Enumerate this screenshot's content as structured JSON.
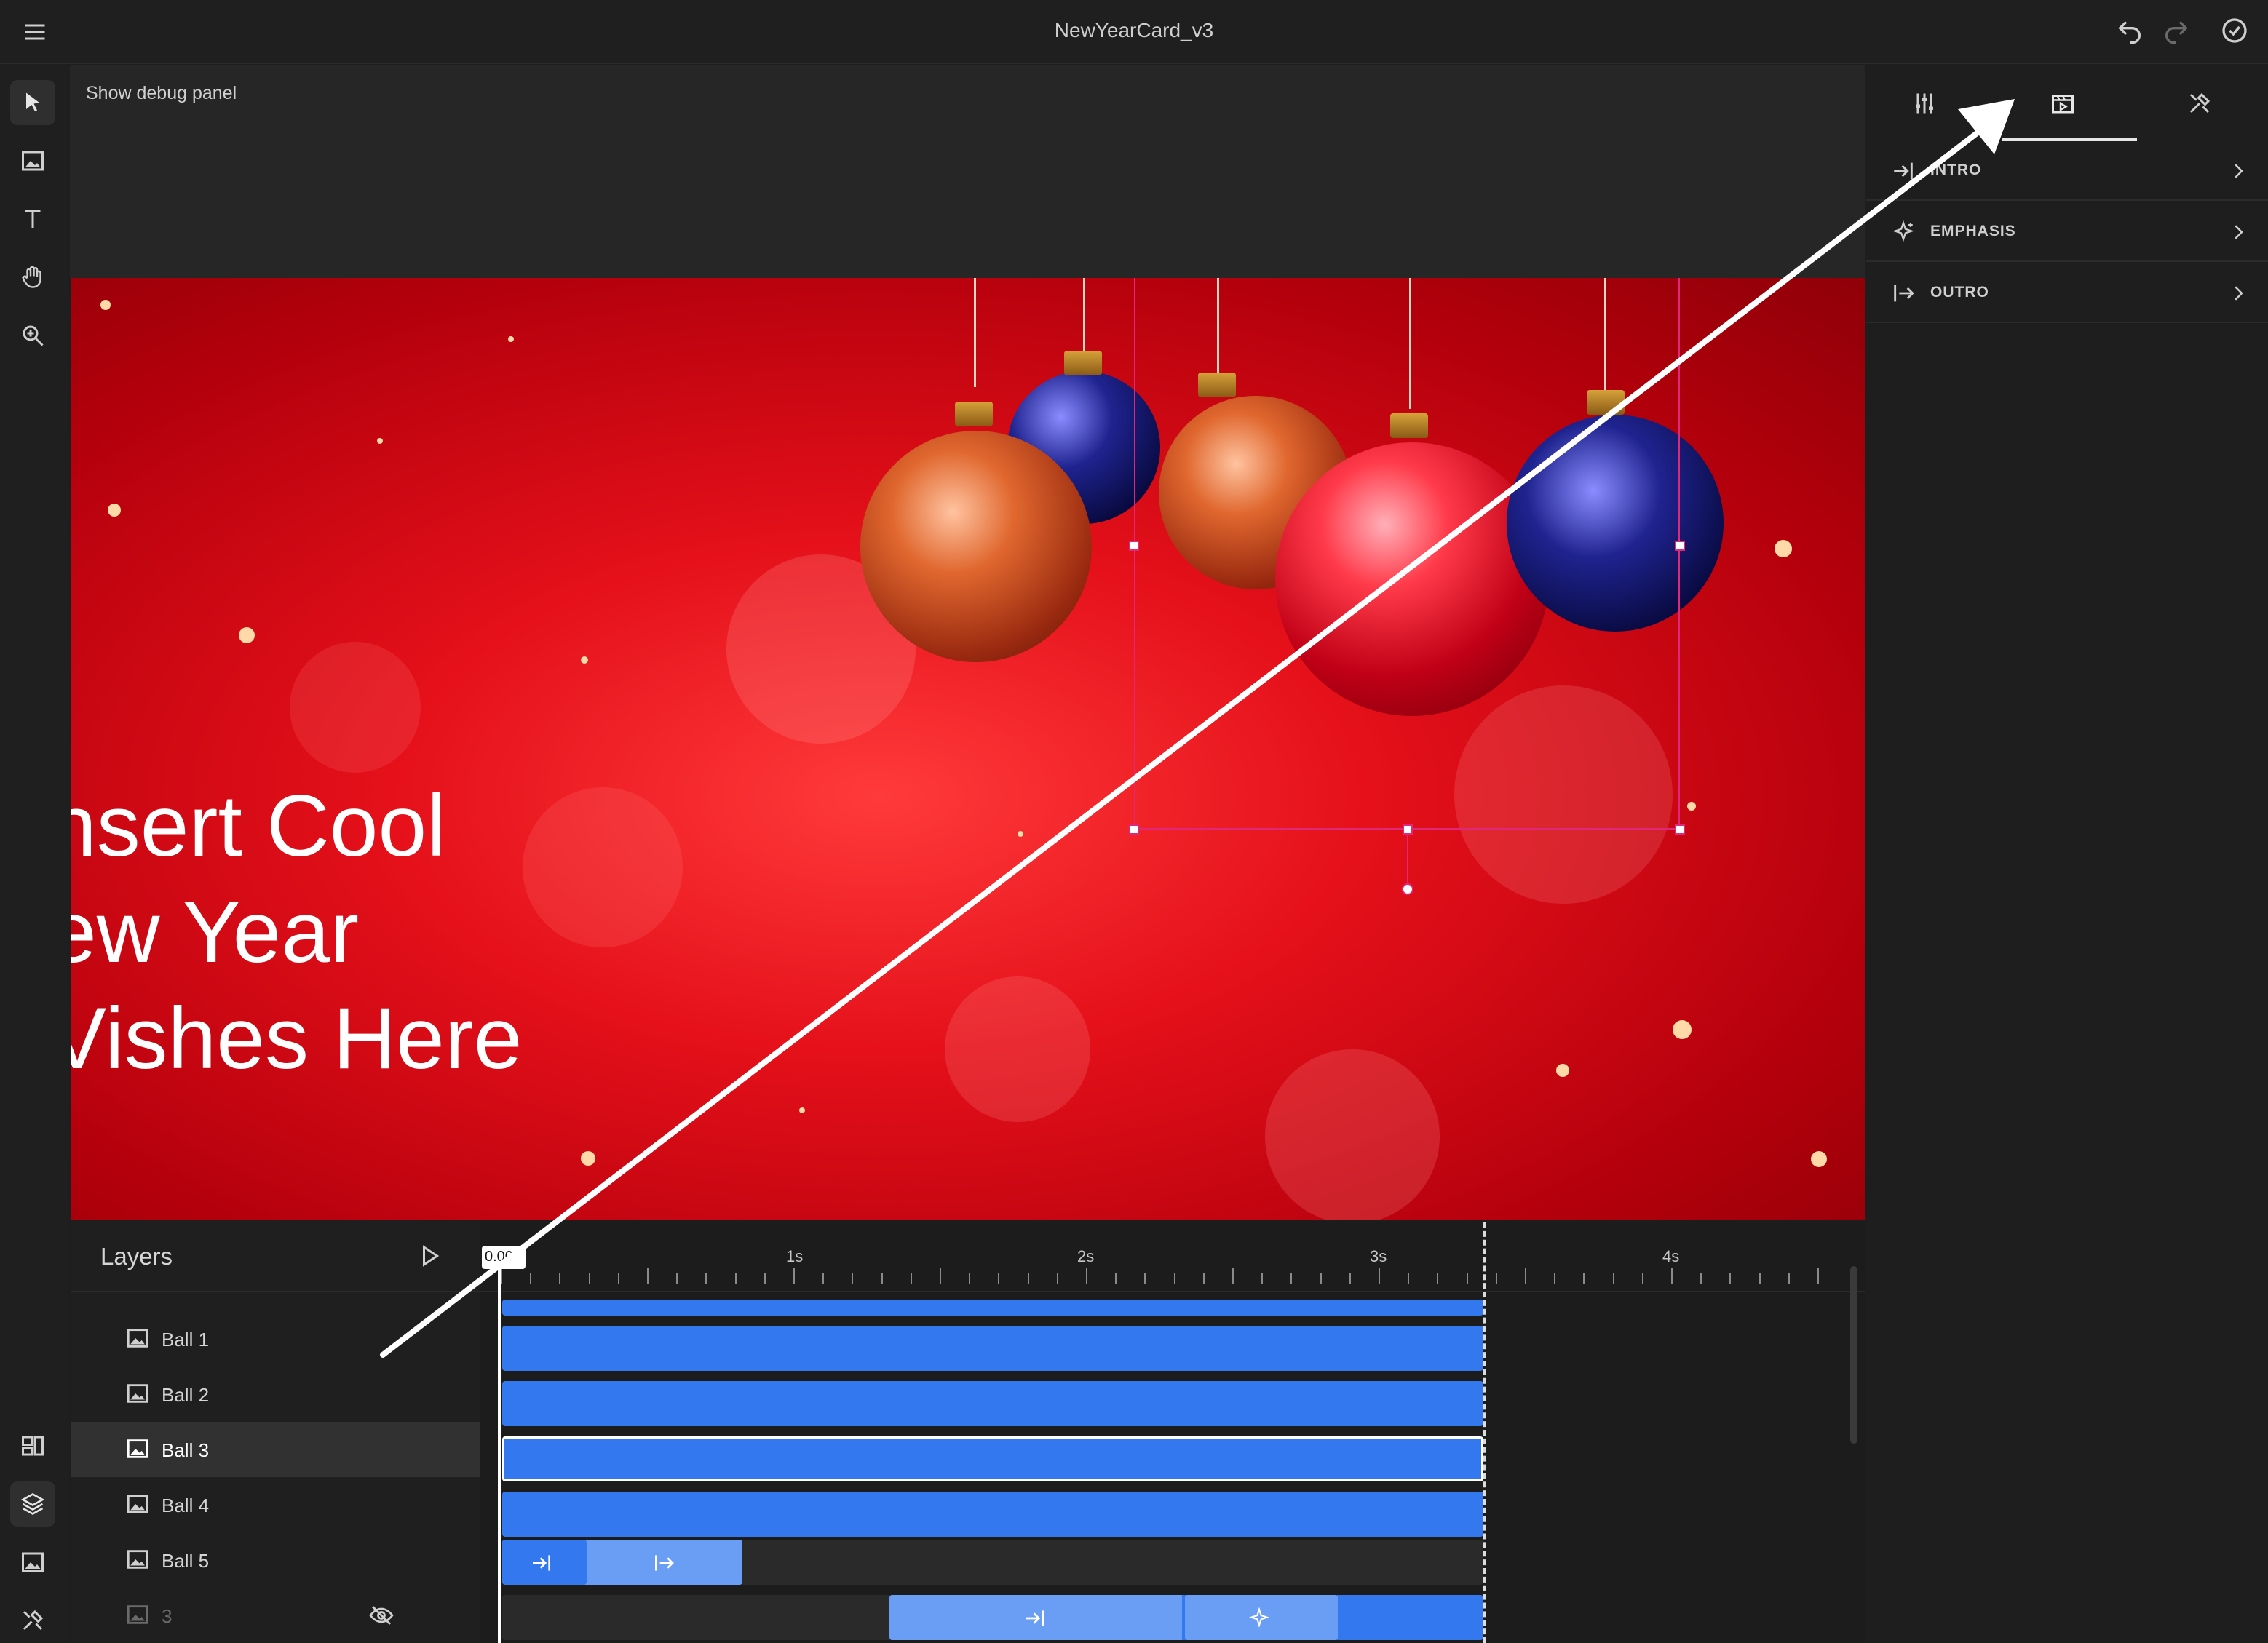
{
  "app": {
    "title": "NewYearCard_v3",
    "icons": {
      "menu": "hamburger-menu-icon",
      "undo": "undo-icon",
      "redo": "redo-icon",
      "done": "check-circle-icon"
    }
  },
  "left_rail": {
    "tools": [
      "select-arrow-icon",
      "image-icon",
      "text-icon",
      "hand-pan-icon",
      "zoom-icon"
    ],
    "bottom": [
      "templates-icon",
      "layers-icon",
      "media-icon",
      "design-tools-icon"
    ]
  },
  "stage": {
    "debug_link": "Show debug panel",
    "canvas_text": "nsert Cool\new Year\nVishes Here",
    "colors": {
      "bg": "#e5101a",
      "selection": "#e0287a"
    }
  },
  "right_panel": {
    "tabs": [
      "adjust-sliders-icon",
      "animation-icon",
      "tools-icon"
    ],
    "active_tab": "animation-icon",
    "sections": [
      {
        "label": "INTRO",
        "icon": "intro-arrow-icon"
      },
      {
        "label": "EMPHASIS",
        "icon": "sparkle-icon"
      },
      {
        "label": "OUTRO",
        "icon": "outro-arrow-icon"
      }
    ]
  },
  "layers": {
    "title": "Layers",
    "play_icon": "play-icon",
    "items": [
      {
        "name": "Ball 1",
        "selected": false,
        "hidden": false
      },
      {
        "name": "Ball 2",
        "selected": false,
        "hidden": false
      },
      {
        "name": "Ball 3",
        "selected": true,
        "hidden": false
      },
      {
        "name": "Ball 4",
        "selected": false,
        "hidden": false
      },
      {
        "name": "Ball 5",
        "selected": false,
        "hidden": false
      },
      {
        "name": "3",
        "selected": false,
        "hidden": true
      }
    ]
  },
  "timeline": {
    "playhead_label": "0.00",
    "time_labels": [
      "1s",
      "2s",
      "3s",
      "4s"
    ],
    "colors": {
      "track": "#3478f0",
      "track_light": "#6a9ef5"
    }
  }
}
